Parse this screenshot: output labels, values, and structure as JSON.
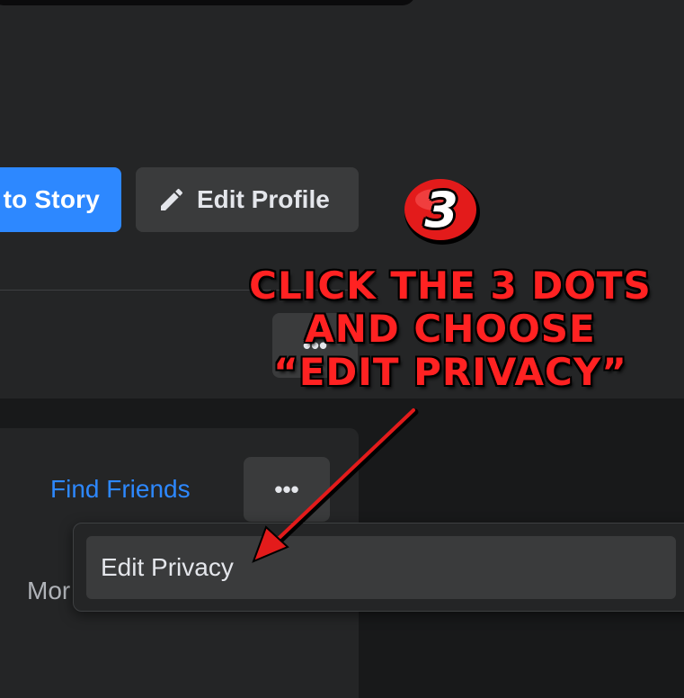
{
  "profile": {
    "add_story_label": "to Story",
    "edit_profile_label": "Edit Profile",
    "edit_profile_icon": "pencil-icon",
    "tabs_more_label": "•••"
  },
  "intro_card": {
    "find_friends_label": "Find Friends",
    "more_label": "•••",
    "partial_text": "Mor"
  },
  "dropdown_menu": {
    "items": [
      {
        "label": "Edit Privacy"
      }
    ]
  },
  "annotation": {
    "step_number": "3",
    "lines": [
      "CLICK THE 3 DOTS",
      "AND CHOOSE",
      "“EDIT PRIVACY”"
    ],
    "text_color": "#ff2222",
    "badge_color": "#e31b1b",
    "arrow_color": "#e31b1b"
  },
  "theme": {
    "background": "#18191a",
    "panel": "#242526",
    "button": "#3a3b3c",
    "accent": "#2d88ff",
    "text": "#e4e6eb",
    "secondary_text": "#b0b3b8"
  }
}
